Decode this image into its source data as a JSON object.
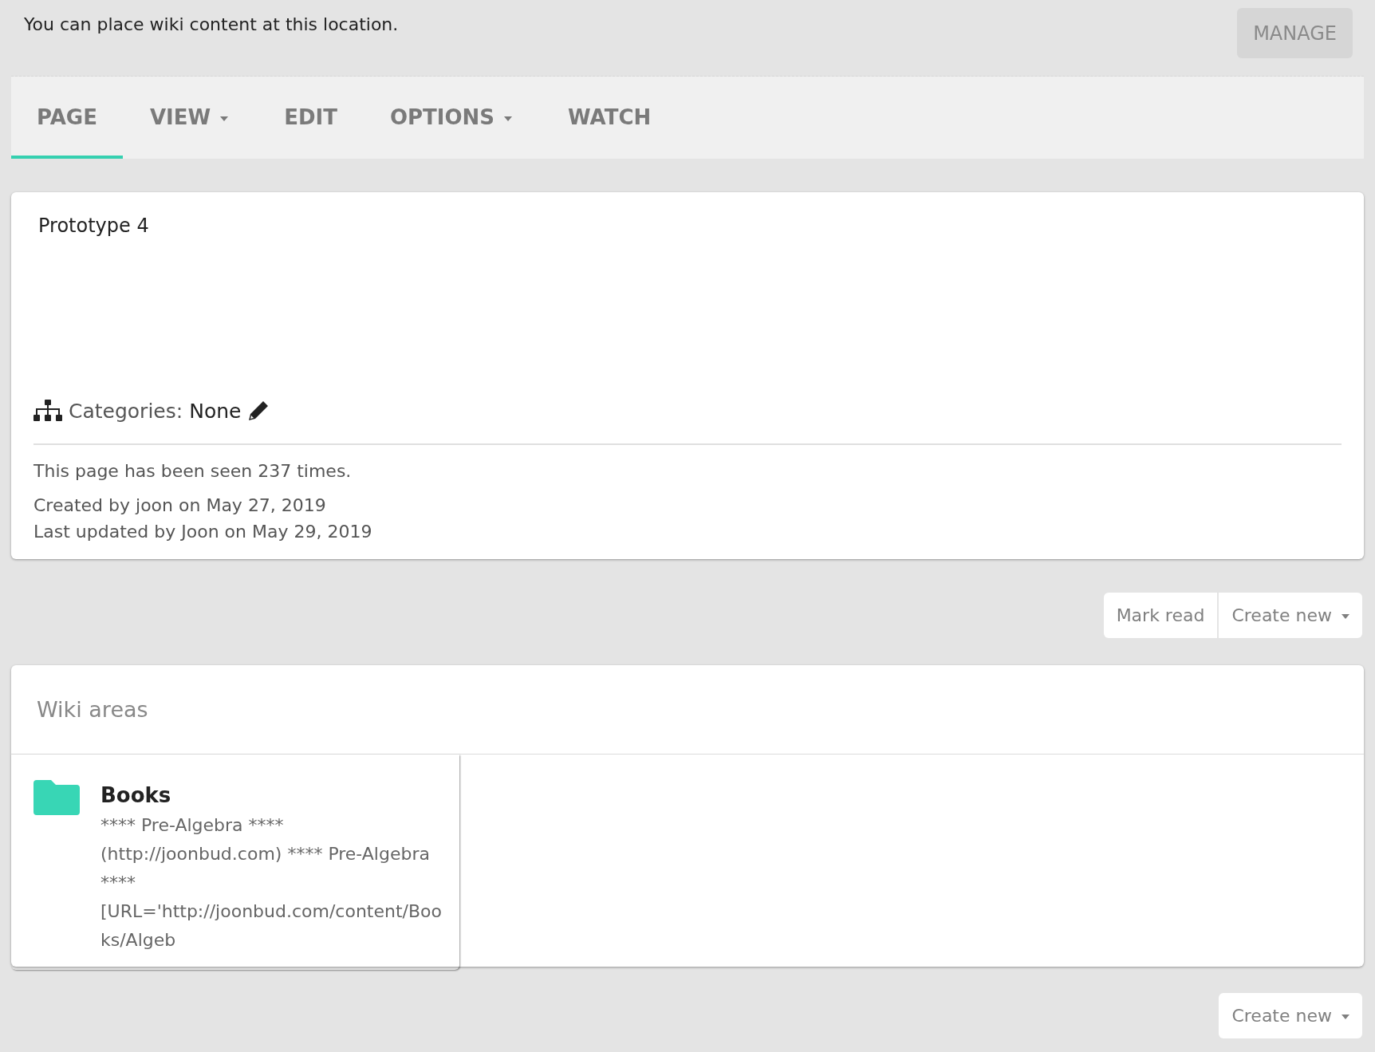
{
  "notice": {
    "text": "You can place wiki content at this location.",
    "button": "MANAGE"
  },
  "tabs": [
    {
      "label": "PAGE",
      "selected": true,
      "dropdown": false
    },
    {
      "label": "VIEW",
      "selected": false,
      "dropdown": true
    },
    {
      "label": "EDIT",
      "selected": false,
      "dropdown": false
    },
    {
      "label": "OPTIONS",
      "selected": false,
      "dropdown": true
    },
    {
      "label": "WATCH",
      "selected": false,
      "dropdown": false
    }
  ],
  "page": {
    "title": "Prototype 4",
    "categories_label": "Categories:",
    "categories_value": "None",
    "views": "This page has been seen 237 times.",
    "created": "Created by joon on May 27, 2019",
    "updated": "Last updated by Joon on May 29, 2019"
  },
  "actions": [
    {
      "label": "Mark read",
      "dropdown": false
    },
    {
      "label": "Create new",
      "dropdown": true
    }
  ],
  "wiki_areas": {
    "title": "Wiki areas",
    "items": [
      {
        "name": "Books",
        "description": "**** Pre-Algebra **** (http://joonbud.com) **** Pre-Algebra **** [URL='http://joonbud.com/content/Books/Algeb"
      }
    ]
  },
  "bottom_actions": [
    {
      "label": "Create new",
      "dropdown": true
    }
  ]
}
